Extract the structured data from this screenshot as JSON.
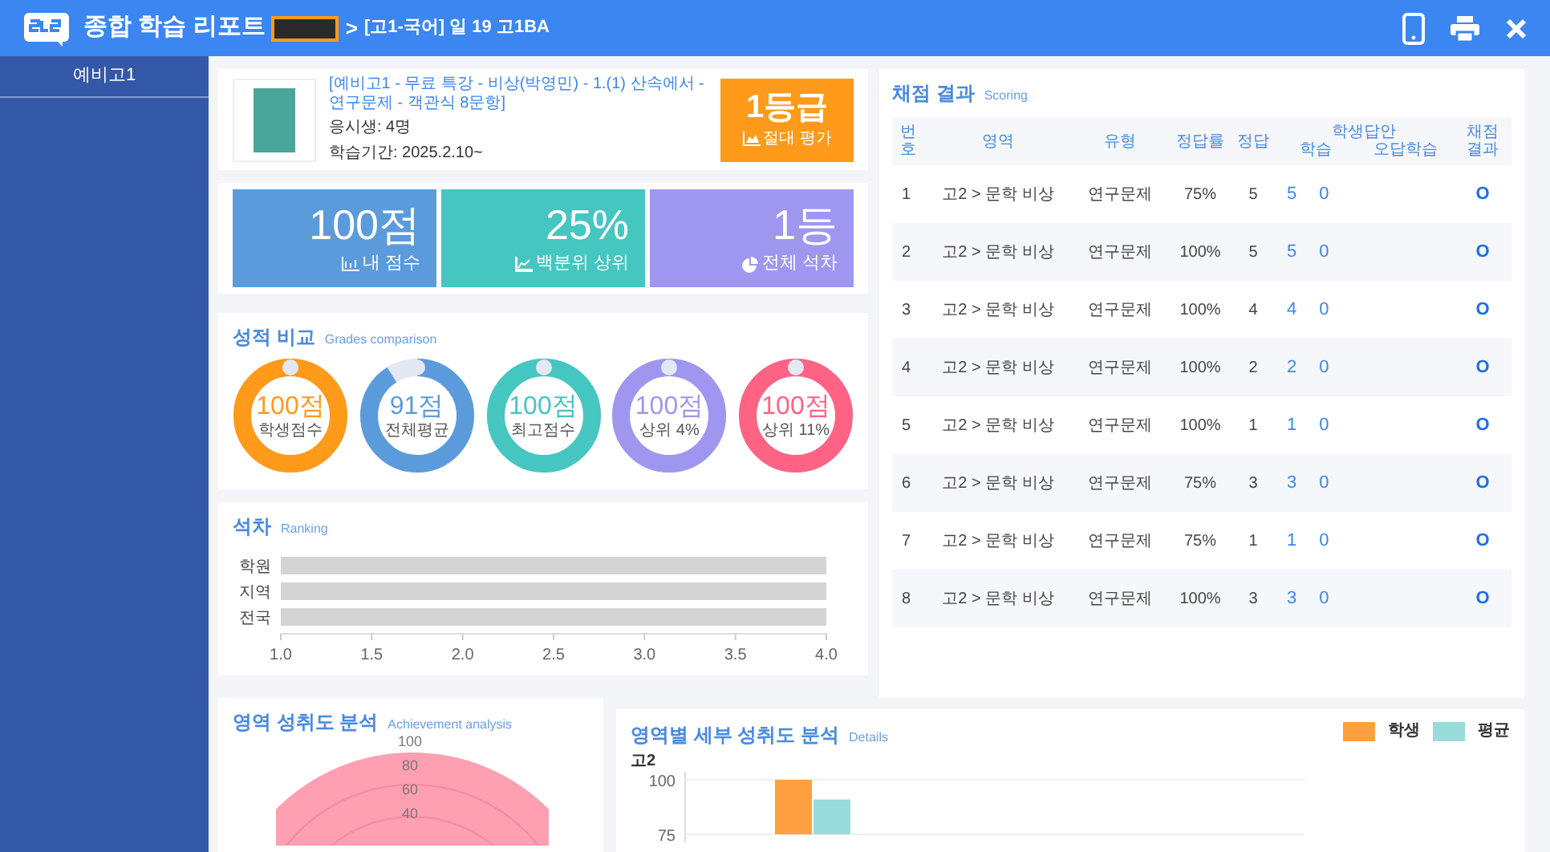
{
  "header": {
    "title": "종합 학습 리포트",
    "separator": ">",
    "breadcrumb": "[고1-국어] 일 19 고1BA"
  },
  "sidebar": {
    "items": [
      {
        "label": "예비고1",
        "selected": true
      }
    ]
  },
  "course": {
    "title": "[예비고1 - 무료 특강 - 비상(박영민) - 1.(1) 산속에서 - 연구문제 - 객관식 8문항]",
    "examinees": "응시생: 4명",
    "period": "학습기간: 2025.2.10~",
    "grade": "1등급",
    "grade_note": "절대 평가"
  },
  "stats": [
    {
      "kind": "score",
      "value": "100점",
      "label": "내 점수",
      "color": "#5b9bdc"
    },
    {
      "kind": "percentile",
      "value": "25%",
      "label": "백분위 상위",
      "color": "#45c6c1"
    },
    {
      "kind": "rank",
      "value": "1등",
      "label": "전체 석차",
      "color": "#9f97ef"
    }
  ],
  "grades_comparison": {
    "title": "성적 비교",
    "subtitle": "Grades comparison",
    "items": [
      {
        "value": "100점",
        "label": "학생점수",
        "level": 1,
        "color": "#ff9a1a"
      },
      {
        "value": "91점",
        "label": "전체평균",
        "level": 0.91,
        "color": "#5b9bdc"
      },
      {
        "value": "100점",
        "label": "최고점수",
        "level": 1,
        "color": "#45c6c1"
      },
      {
        "value": "100점",
        "label": "상위 4%",
        "level": 1,
        "color": "#9f97ef"
      },
      {
        "value": "100점",
        "label": "상위 11%",
        "level": 1,
        "color": "#ff6384"
      }
    ]
  },
  "ranking": {
    "title": "석차",
    "subtitle": "Ranking",
    "chart_data": {
      "type": "bar",
      "orientation": "horizontal",
      "categories": [
        "학원",
        "지역",
        "전국"
      ],
      "values": [
        4,
        4,
        4
      ],
      "xlim": [
        1,
        4
      ],
      "xticks": [
        {
          "value": 1,
          "label": "1.0"
        },
        {
          "value": 1.5,
          "label": "1.5"
        },
        {
          "value": 2,
          "label": "2.0"
        },
        {
          "value": 2.5,
          "label": "2.5"
        },
        {
          "value": 3,
          "label": "3.0"
        },
        {
          "value": 3.5,
          "label": "3.5"
        },
        {
          "value": 4,
          "label": "4.0"
        }
      ]
    }
  },
  "scoring": {
    "title": "채점 결과",
    "subtitle": "Scoring",
    "columns": [
      "번호",
      "영역",
      "유형",
      "정답률",
      "정답",
      "학생답안",
      "학습",
      "오답학습",
      "채점결과"
    ],
    "rows": [
      {
        "no": "1",
        "area": "고2 > 문학 비상",
        "type": "연구문제",
        "rate": "75%",
        "answer": "5",
        "student_answer": "5",
        "study": "0",
        "result": "O"
      },
      {
        "no": "2",
        "area": "고2 > 문학 비상",
        "type": "연구문제",
        "rate": "100%",
        "answer": "5",
        "student_answer": "5",
        "study": "0",
        "result": "O"
      },
      {
        "no": "3",
        "area": "고2 > 문학 비상",
        "type": "연구문제",
        "rate": "100%",
        "answer": "4",
        "student_answer": "4",
        "study": "0",
        "result": "O"
      },
      {
        "no": "4",
        "area": "고2 > 문학 비상",
        "type": "연구문제",
        "rate": "100%",
        "answer": "2",
        "student_answer": "2",
        "study": "0",
        "result": "O"
      },
      {
        "no": "5",
        "area": "고2 > 문학 비상",
        "type": "연구문제",
        "rate": "100%",
        "answer": "1",
        "student_answer": "1",
        "study": "0",
        "result": "O"
      },
      {
        "no": "6",
        "area": "고2 > 문학 비상",
        "type": "연구문제",
        "rate": "75%",
        "answer": "3",
        "student_answer": "3",
        "study": "0",
        "result": "O"
      },
      {
        "no": "7",
        "area": "고2 > 문학 비상",
        "type": "연구문제",
        "rate": "75%",
        "answer": "1",
        "student_answer": "1",
        "study": "0",
        "result": "O"
      },
      {
        "no": "8",
        "area": "고2 > 문학 비상",
        "type": "연구문제",
        "rate": "100%",
        "answer": "3",
        "student_answer": "3",
        "study": "0",
        "result": "O"
      }
    ]
  },
  "achievement": {
    "title": "영역 성취도 분석",
    "subtitle": "Achievement analysis",
    "ticks": [
      "100",
      "80",
      "60",
      "40"
    ]
  },
  "details": {
    "title": "영역별 세부 성취도 분석",
    "subtitle": "Details",
    "chart_data": {
      "type": "bar",
      "title": "고2",
      "series": [
        {
          "name": "학생",
          "color": "#ffa040",
          "values": [
            100
          ]
        },
        {
          "name": "평균",
          "color": "#98dcdc",
          "values": [
            91
          ]
        }
      ],
      "ylim": [
        75,
        100
      ],
      "yticks": [
        75,
        100
      ]
    }
  }
}
